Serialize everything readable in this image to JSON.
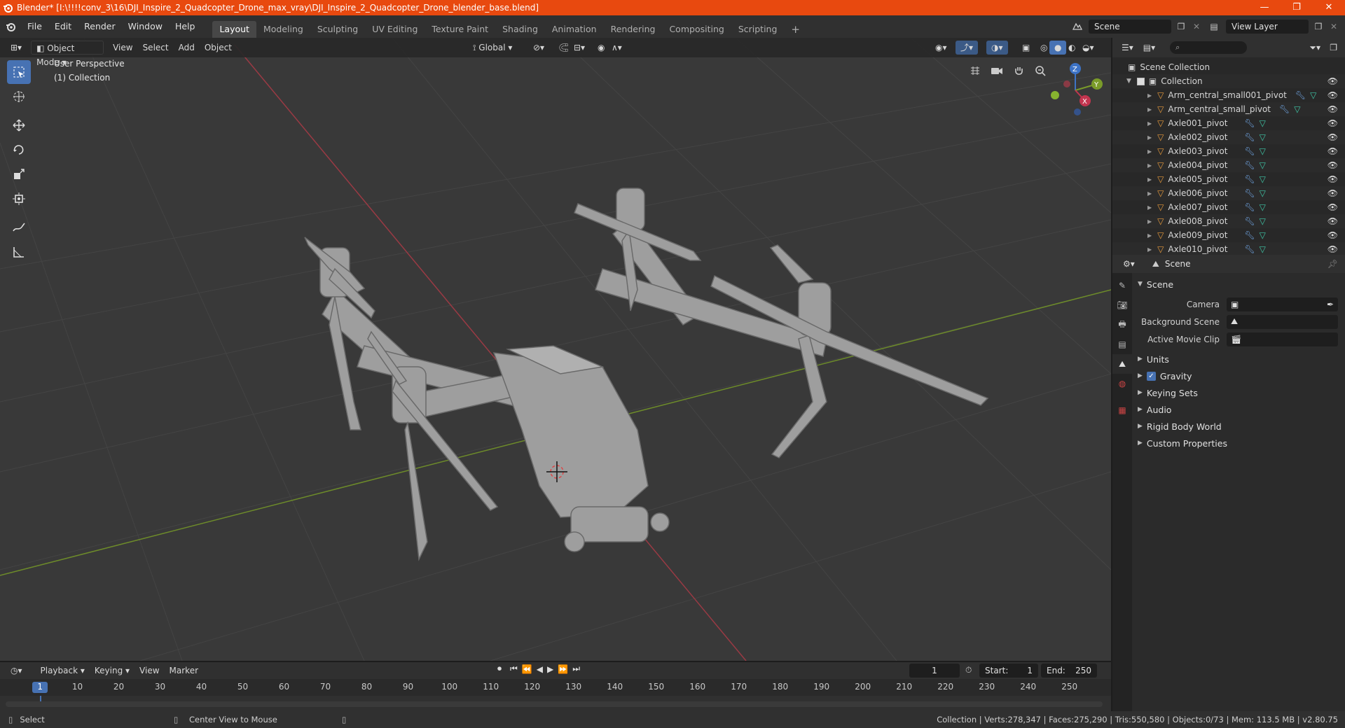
{
  "window": {
    "title": "Blender* [I:\\!!!!conv_3\\16\\DJI_Inspire_2_Quadcopter_Drone_max_vray\\DJI_Inspire_2_Quadcopter_Drone_blender_base.blend]",
    "buttons": [
      "—",
      "❐",
      "✕"
    ]
  },
  "menu": [
    "File",
    "Edit",
    "Render",
    "Window",
    "Help"
  ],
  "workspaces": [
    "Layout",
    "Modeling",
    "Sculpting",
    "UV Editing",
    "Texture Paint",
    "Shading",
    "Animation",
    "Rendering",
    "Compositing",
    "Scripting"
  ],
  "workspace_add": "+",
  "scene_name": "Scene",
  "view_layer": "View Layer",
  "viewport": {
    "mode": "Object Mode",
    "menus": [
      "View",
      "Select",
      "Add",
      "Object"
    ],
    "transform_orientation": "Global",
    "perspective_label": "User Perspective",
    "collection_label": "(1) Collection",
    "gizmo": {
      "x": "X",
      "y": "Y",
      "z": "Z"
    },
    "colors": {
      "x_axis": "#9a3a44",
      "y_axis": "#6d8b2a",
      "background": "#393939",
      "model": "#9e9e9e"
    }
  },
  "tools": [
    "select-box-icon",
    "cursor-icon",
    "move-icon",
    "rotate-icon",
    "scale-icon",
    "transform-icon",
    "annotate-icon",
    "measure-icon"
  ],
  "outliner": {
    "root": "Scene Collection",
    "collection": "Collection",
    "items": [
      {
        "name": "Arm_central_small001_pivot"
      },
      {
        "name": "Arm_central_small_pivot"
      },
      {
        "name": "Axle001_pivot"
      },
      {
        "name": "Axle002_pivot"
      },
      {
        "name": "Axle003_pivot"
      },
      {
        "name": "Axle004_pivot"
      },
      {
        "name": "Axle005_pivot"
      },
      {
        "name": "Axle006_pivot"
      },
      {
        "name": "Axle007_pivot"
      },
      {
        "name": "Axle008_pivot"
      },
      {
        "name": "Axle009_pivot"
      },
      {
        "name": "Axle010_pivot"
      }
    ]
  },
  "properties": {
    "context": "Scene",
    "panel": "Scene",
    "fields": [
      {
        "label": "Camera"
      },
      {
        "label": "Background Scene"
      },
      {
        "label": "Active Movie Clip"
      }
    ],
    "sections": [
      "Units",
      "Gravity",
      "Keying Sets",
      "Audio",
      "Rigid Body World",
      "Custom Properties"
    ],
    "gravity_checked": true
  },
  "timeline": {
    "menus": [
      "Playback",
      "Keying",
      "View",
      "Marker"
    ],
    "current_frame": "1",
    "start_label": "Start:",
    "start": "1",
    "end_label": "End:",
    "end": "250",
    "ticks": [
      "1",
      "10",
      "20",
      "30",
      "40",
      "50",
      "60",
      "70",
      "80",
      "90",
      "100",
      "110",
      "120",
      "130",
      "140",
      "150",
      "160",
      "170",
      "180",
      "190",
      "200",
      "210",
      "220",
      "230",
      "240",
      "250"
    ]
  },
  "status": {
    "left": "Select",
    "middle": "Center View to Mouse",
    "right": "Collection | Verts:278,347 | Faces:275,290 | Tris:550,580 | Objects:0/73 | Mem: 113.5 MB | v2.80.75"
  }
}
